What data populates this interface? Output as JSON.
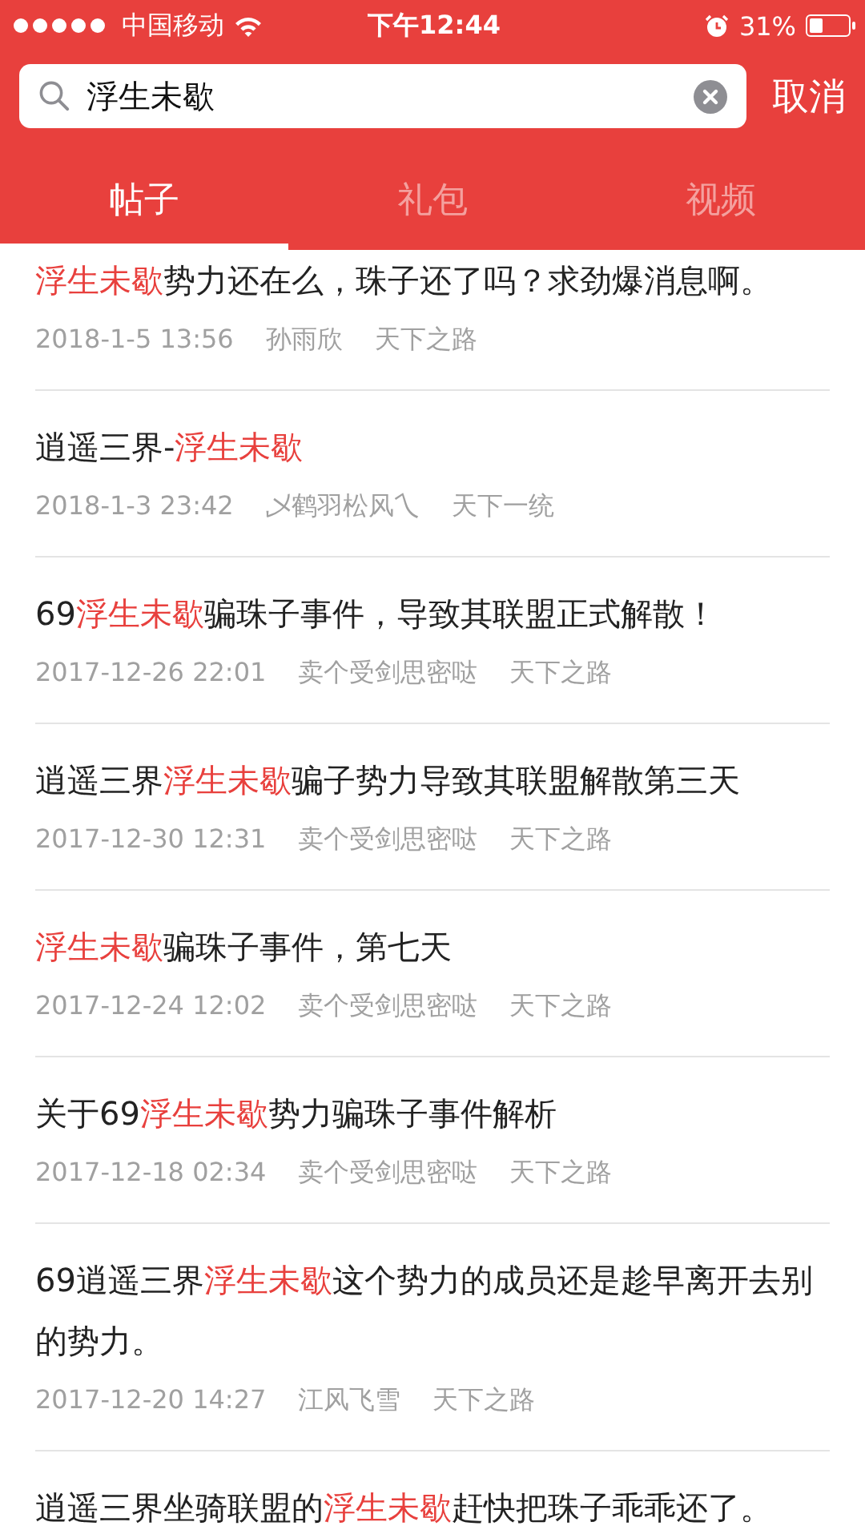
{
  "status_bar": {
    "carrier": "中国移动",
    "time": "下午12:44",
    "battery": "31%"
  },
  "search": {
    "value": "浮生未歇",
    "cancel": "取消"
  },
  "tabs": [
    {
      "label": "帖子",
      "selected": true
    },
    {
      "label": "礼包",
      "selected": false
    },
    {
      "label": "视频",
      "selected": false
    }
  ],
  "posts": [
    {
      "title": [
        {
          "text": "浮生未歇",
          "highlight": true
        },
        {
          "text": "势力还在么，珠子还了吗？求劲爆消息啊。",
          "highlight": false
        }
      ],
      "time": "2018-1-5 13:56",
      "author": "孙雨欣",
      "server": "天下之路"
    },
    {
      "title": [
        {
          "text": "逍遥三界-",
          "highlight": false
        },
        {
          "text": "浮生未歇",
          "highlight": true
        }
      ],
      "time": "2018-1-3 23:42",
      "author": "乄鹤羽松风乀",
      "server": "天下一统"
    },
    {
      "title": [
        {
          "text": "69",
          "highlight": false
        },
        {
          "text": "浮生未歇",
          "highlight": true
        },
        {
          "text": "骗珠子事件，导致其联盟正式解散！",
          "highlight": false
        }
      ],
      "time": "2017-12-26 22:01",
      "author": "卖个受剑思密哒",
      "server": "天下之路"
    },
    {
      "title": [
        {
          "text": "逍遥三界",
          "highlight": false
        },
        {
          "text": "浮生未歇",
          "highlight": true
        },
        {
          "text": "骗子势力导致其联盟解散第三天",
          "highlight": false
        }
      ],
      "time": "2017-12-30 12:31",
      "author": "卖个受剑思密哒",
      "server": "天下之路"
    },
    {
      "title": [
        {
          "text": "浮生未歇",
          "highlight": true
        },
        {
          "text": "骗珠子事件，第七天",
          "highlight": false
        }
      ],
      "time": "2017-12-24 12:02",
      "author": "卖个受剑思密哒",
      "server": "天下之路"
    },
    {
      "title": [
        {
          "text": "关于69",
          "highlight": false
        },
        {
          "text": "浮生未歇",
          "highlight": true
        },
        {
          "text": "势力骗珠子事件解析",
          "highlight": false
        }
      ],
      "time": "2017-12-18 02:34",
      "author": "卖个受剑思密哒",
      "server": "天下之路"
    },
    {
      "title": [
        {
          "text": "69逍遥三界",
          "highlight": false
        },
        {
          "text": "浮生未歇",
          "highlight": true
        },
        {
          "text": "这个势力的成员还是趁早离开去别的势力。",
          "highlight": false
        }
      ],
      "time": "2017-12-20 14:27",
      "author": "江风飞雪",
      "server": "天下之路"
    },
    {
      "title": [
        {
          "text": "逍遥三界坐骑联盟的",
          "highlight": false
        },
        {
          "text": "浮生未歇",
          "highlight": true
        },
        {
          "text": "赶快把珠子乖乖还了。",
          "highlight": false
        }
      ]
    }
  ]
}
